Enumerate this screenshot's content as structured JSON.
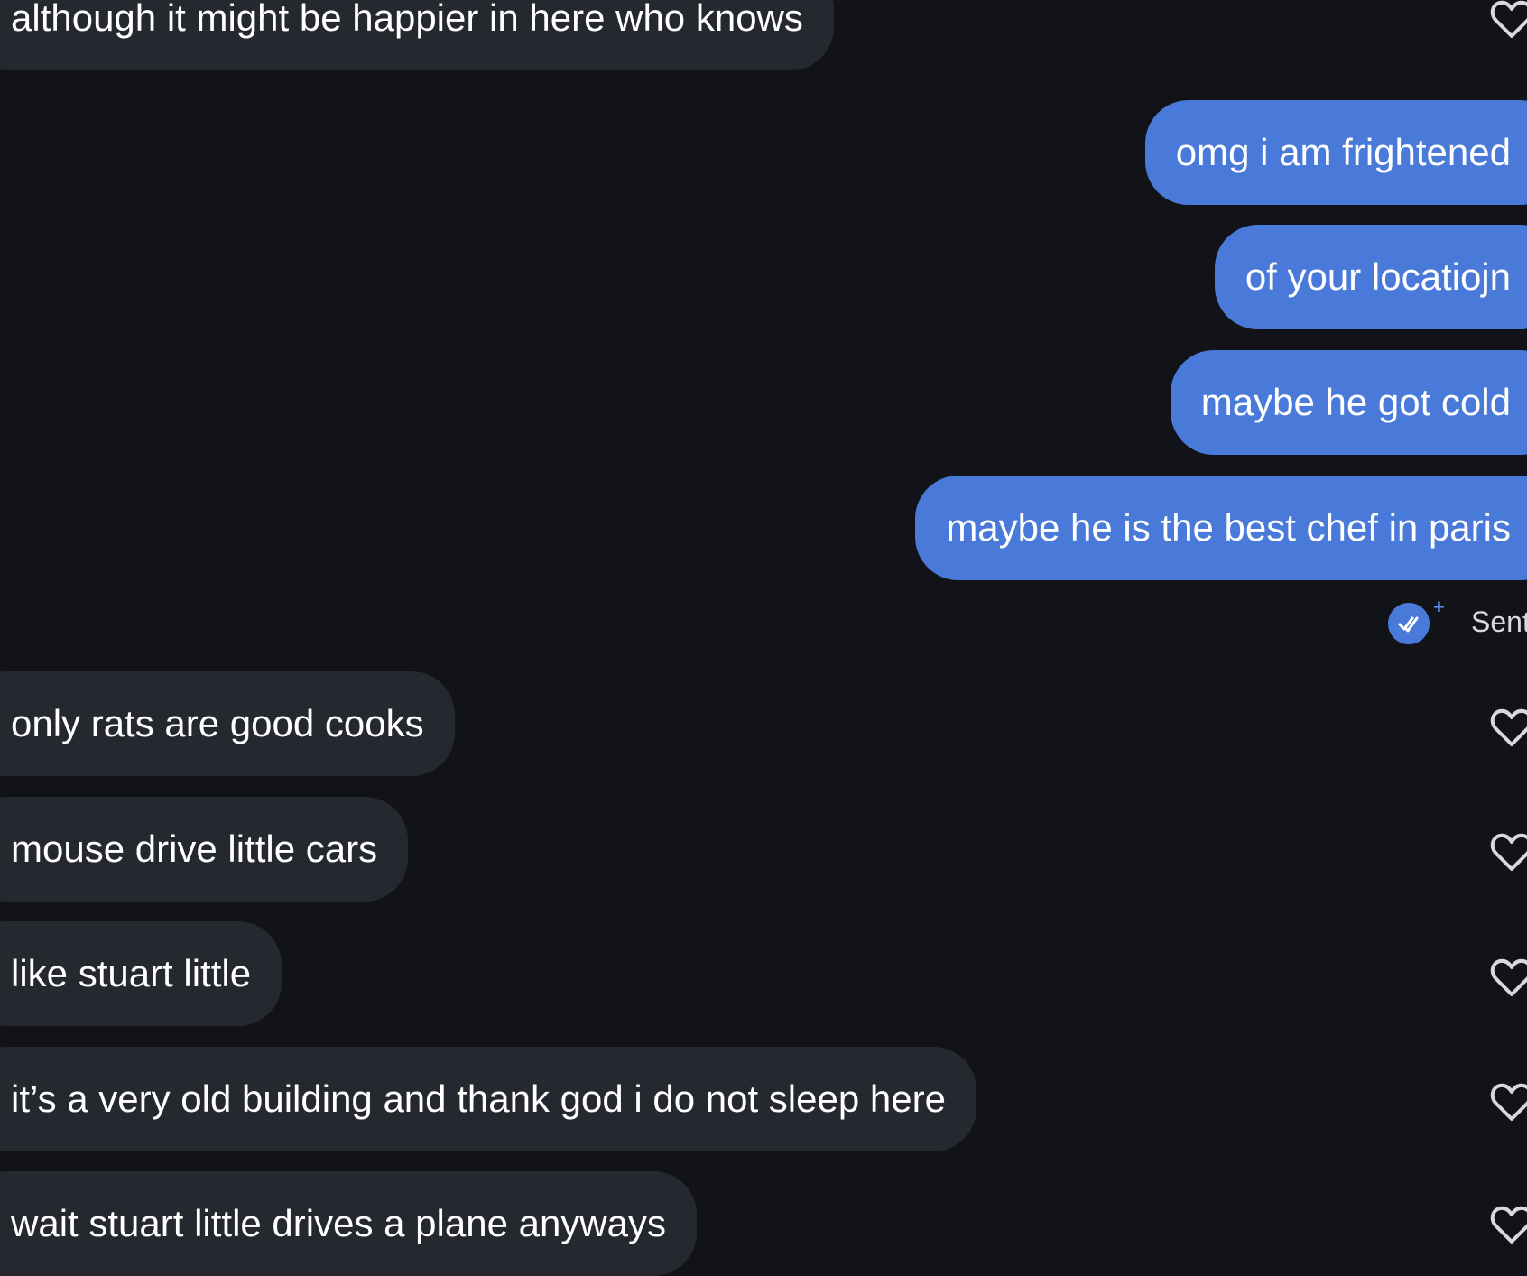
{
  "messages": [
    {
      "from": "them",
      "text": "although it might be happier in here who knows",
      "liked": false
    },
    {
      "from": "me",
      "text": "omg i am frightened"
    },
    {
      "from": "me",
      "text": "of your locatiojn"
    },
    {
      "from": "me",
      "text": "maybe he got cold"
    },
    {
      "from": "me",
      "text": "maybe he is the best chef in paris"
    },
    {
      "from": "them",
      "text": "only rats are good cooks",
      "liked": false
    },
    {
      "from": "them",
      "text": "mouse drive little cars",
      "liked": false
    },
    {
      "from": "them",
      "text": "like stuart little",
      "liked": false
    },
    {
      "from": "them",
      "text": "it’s a very old building and thank god i do not sleep here",
      "liked": false
    },
    {
      "from": "them",
      "text": "wait stuart little drives a plane anyways",
      "liked": false
    }
  ],
  "status": {
    "text": "Sent",
    "icon": "double-check-icon",
    "plus": "+"
  },
  "colors": {
    "background": "#121318",
    "received_bubble": "#262830",
    "sent_bubble": "#4a7ad9",
    "heart_outline": "#d8d9de"
  }
}
